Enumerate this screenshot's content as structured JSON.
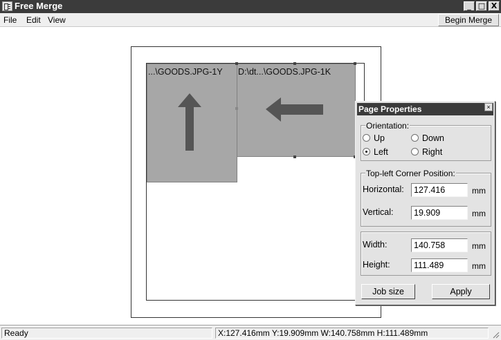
{
  "window": {
    "title": "Free Merge",
    "controls": {
      "minimize": "_",
      "maximize": "□",
      "close": "X"
    }
  },
  "menubar": {
    "items": [
      "File",
      "Edit",
      "View"
    ],
    "begin_merge_label": "Begin Merge"
  },
  "canvas": {
    "images": [
      {
        "label": "...\\GOODS.JPG-1Y",
        "arrow": "arrow-up-icon"
      },
      {
        "label": "D:\\dt...\\GOODS.JPG-1K",
        "arrow": "arrow-left-icon"
      }
    ]
  },
  "page_properties": {
    "title": "Page Properties",
    "close_glyph": "×",
    "orientation": {
      "legend": "Orientation:",
      "options": [
        {
          "label": "Up",
          "selected": false
        },
        {
          "label": "Down",
          "selected": false
        },
        {
          "label": "Left",
          "selected": true
        },
        {
          "label": "Right",
          "selected": false
        }
      ]
    },
    "position": {
      "legend": "Top-left Corner Position:",
      "horizontal_label": "Horizontal:",
      "horizontal_value": "127.416",
      "vertical_label": "Vertical:",
      "vertical_value": "19.909",
      "unit": "mm"
    },
    "size": {
      "width_label": "Width:",
      "width_value": "140.758",
      "height_label": "Height:",
      "height_value": "111.489",
      "unit": "mm"
    },
    "job_size_label": "Job size",
    "apply_label": "Apply"
  },
  "statusbar": {
    "ready": "Ready",
    "coords": "X:127.416mm Y:19.909mm W:140.758mm H:111.489mm"
  },
  "colors": {
    "titlebar": "#3b3b3b",
    "image_fill": "#a7a7a7",
    "arrow": "#555555",
    "dialog_bg": "#e3e3e3"
  }
}
